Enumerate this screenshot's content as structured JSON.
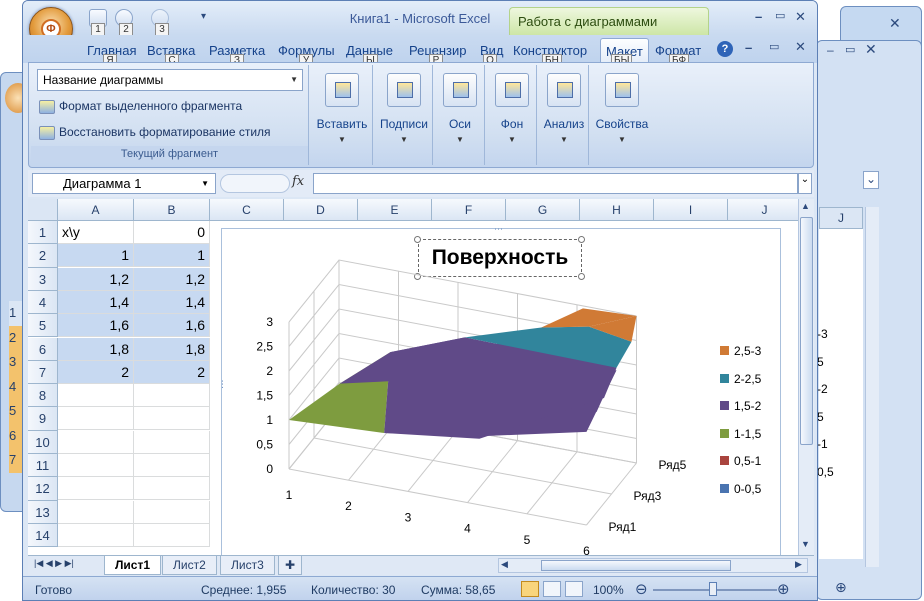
{
  "window": {
    "title": "Книга1 - Microsoft Excel",
    "context_tools": "Работа с диаграммами",
    "office_button": "Ф"
  },
  "qat_keytips": [
    "1",
    "2",
    "3"
  ],
  "tabs": [
    {
      "label": "Главная",
      "keytip": "Я"
    },
    {
      "label": "Вставка",
      "keytip": "С"
    },
    {
      "label": "Разметка",
      "keytip": "З"
    },
    {
      "label": "Формулы",
      "keytip": "У"
    },
    {
      "label": "Данные",
      "keytip": "Ы"
    },
    {
      "label": "Рецензир",
      "keytip": "Р"
    },
    {
      "label": "Вид",
      "keytip": "О"
    },
    {
      "label": "Конструктор",
      "keytip": "БН"
    },
    {
      "label": "Макет",
      "keytip": "БЫ"
    },
    {
      "label": "Формат",
      "keytip": "БФ"
    }
  ],
  "ribbon": {
    "selection_combo": "Название диаграммы",
    "format_selection": "Формат выделенного фрагмента",
    "reset_style": "Восстановить форматирование стиля",
    "current_group": "Текущий фрагмент",
    "buttons": [
      "Вставить",
      "Подписи",
      "Оси",
      "Фон",
      "Анализ",
      "Свойства"
    ]
  },
  "formula_bar": {
    "name_box": "Диаграмма 1",
    "fx": "fx",
    "value": ""
  },
  "columns": [
    "A",
    "B",
    "C",
    "D",
    "E",
    "F",
    "G",
    "H",
    "I",
    "J"
  ],
  "rows": [
    "1",
    "2",
    "3",
    "4",
    "5",
    "6",
    "7",
    "8",
    "9",
    "10",
    "11",
    "12",
    "13",
    "14"
  ],
  "cells": [
    [
      "x\\y",
      "0"
    ],
    [
      "1",
      "1"
    ],
    [
      "1,2",
      "1,2"
    ],
    [
      "1,4",
      "1,4"
    ],
    [
      "1,6",
      "1,6"
    ],
    [
      "1,8",
      "1,8"
    ],
    [
      "2",
      "2"
    ]
  ],
  "chart_data": {
    "type": "surface",
    "title": "Поверхность",
    "z_axis_ticks": [
      "0",
      "0,5",
      "1",
      "1,5",
      "2",
      "2,5",
      "3"
    ],
    "x_categories": [
      "1",
      "2",
      "3",
      "4",
      "5",
      "6"
    ],
    "series_labels": [
      "Ряд1",
      "Ряд3",
      "Ряд5"
    ],
    "legend": [
      {
        "label": "2,5-3",
        "color": "#d07a35"
      },
      {
        "label": "2-2,5",
        "color": "#31859c"
      },
      {
        "label": "1,5-2",
        "color": "#604a88"
      },
      {
        "label": "1-1,5",
        "color": "#7e9c3f"
      },
      {
        "label": "0,5-1",
        "color": "#a9443e"
      },
      {
        "label": "0-0,5",
        "color": "#4a74b0"
      }
    ],
    "legend_position": "right"
  },
  "sheet_tabs": [
    "Лист1",
    "Лист2",
    "Лист3"
  ],
  "status": {
    "ready": "Готово",
    "average": "Среднее: 1,955",
    "count": "Количество: 30",
    "sum": "Сумма: 58,65",
    "zoom": "100%"
  },
  "bg_window": {
    "rows": [
      "1",
      "2",
      "3",
      "4",
      "5",
      "6",
      "7"
    ],
    "legend_text": [
      "-3",
      "5",
      "-2",
      "5",
      "-1",
      "0,5"
    ],
    "col": "J"
  }
}
